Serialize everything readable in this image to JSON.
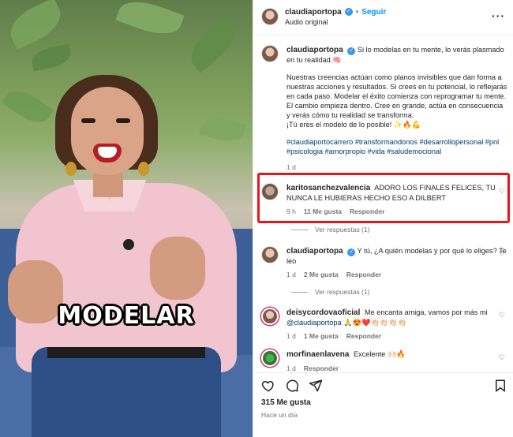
{
  "media": {
    "overlay_word": "MODELAR"
  },
  "header": {
    "username": "claudiaportopa",
    "verified_mark": "✓",
    "separator": "•",
    "follow": "Seguir",
    "subtitle": "Audio original",
    "more": "···"
  },
  "caption": {
    "username": "claudiaportopa",
    "line1": "Si lo modelas en tu mente, lo verás plasmado en tu realidad.🧠",
    "para2": "Nuestras creencias actúan como planos invisibles que dan forma a nuestras acciones y resultados. Si crees en tu potencial, lo reflejarás en cada paso. Modelar el éxito comienza con reprogramar tu mente. El cambio empieza dentro. Cree en grande, actúa en consecuencia y verás cómo tu realidad se transforma.",
    "para2_end": "¡Tú eres el modelo de lo posible! ✨🔥💪",
    "hashtags": "#claudiaportocarrero #transformandonos #desarrollopersonal #pnl #psicologia #amorpropio #vida #saludemocional",
    "age": "1 d"
  },
  "comments": [
    {
      "username": "karitosanchezvalencia",
      "text": "ADORO LOS FINALES FELICES, TU NUNCA LE HUBIERAS HECHO ESO A DILBERT",
      "age": "9 h",
      "likes": "11 Me gusta",
      "reply": "Responder",
      "view_replies": "Ver respuestas (1)"
    },
    {
      "username": "claudiaportopa",
      "text": "Y tú, ¿A quién modelas y por qué lo eliges? Te leo",
      "age": "1 d",
      "likes": "2 Me gusta",
      "reply": "Responder",
      "view_replies": "Ver respuestas (1)"
    },
    {
      "username": "deisycordovaoficial",
      "text": "Me encanta amiga, vamos por más mi",
      "mention": "@claudiaportopa",
      "emojis": "🙏😍❤️👏🏻👏🏻👏🏻👏🏻",
      "age": "1 d",
      "likes": "1 Me gusta",
      "reply": "Responder"
    },
    {
      "username": "morfinaenlavena",
      "text": "Excelente 🙌🏻🔥",
      "age": "1 d",
      "reply": "Responder"
    }
  ],
  "actions": {
    "like_icon": "heart-icon",
    "comment_icon": "comment-icon",
    "share_icon": "share-icon",
    "bookmark_icon": "bookmark-icon"
  },
  "footer": {
    "likes": "315 Me gusta",
    "time": "Hace un día"
  },
  "colors": {
    "highlight": "#e8141c",
    "link": "#00376b",
    "follow": "#0095f6"
  }
}
